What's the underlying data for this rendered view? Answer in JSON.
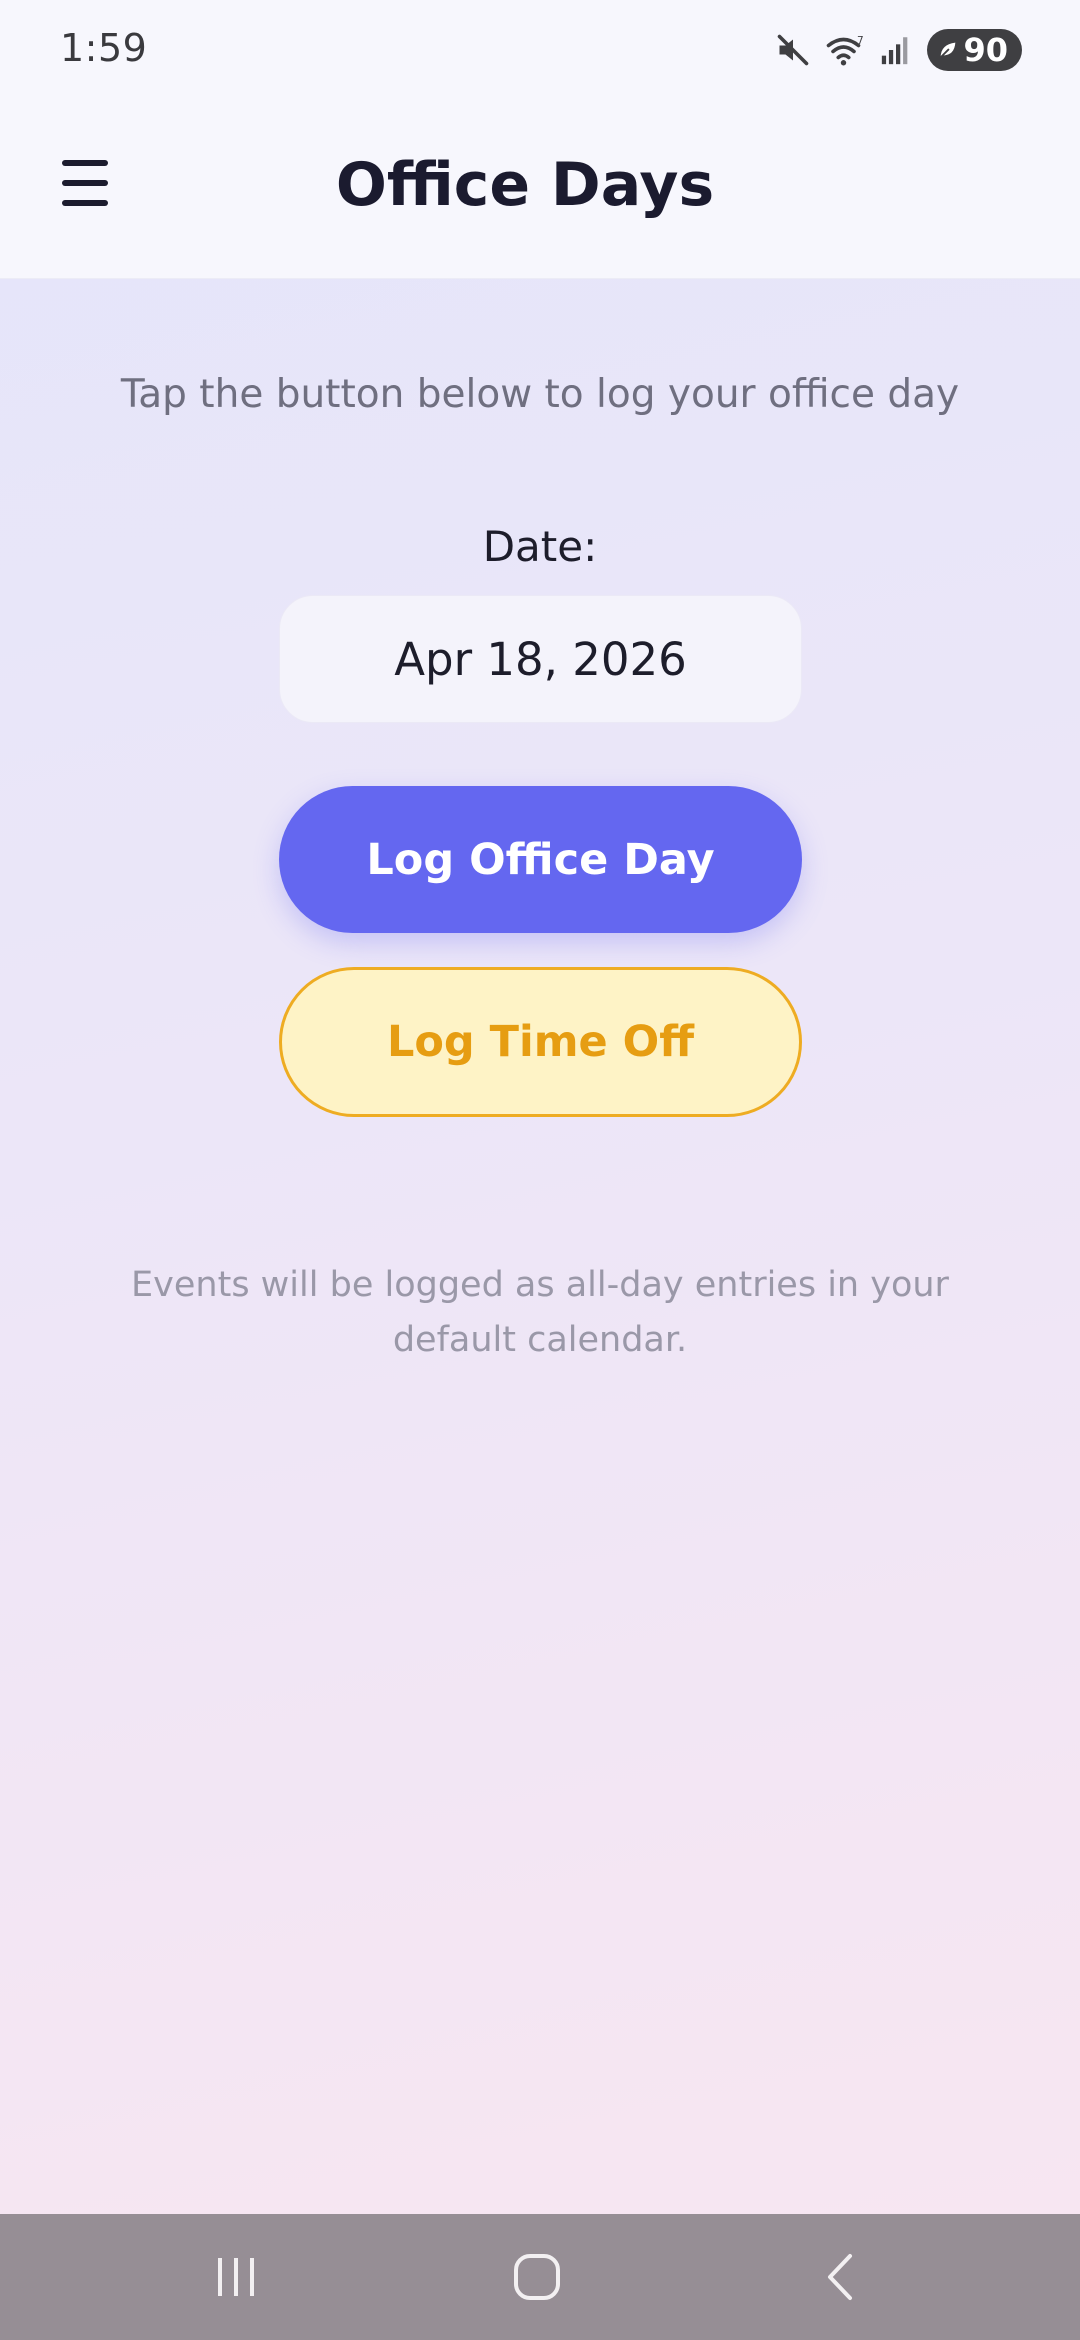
{
  "status_bar": {
    "time": "1:59",
    "battery_level": "90",
    "icons": [
      "mute-icon",
      "wifi-icon",
      "signal-icon",
      "battery-icon"
    ]
  },
  "app_bar": {
    "menu_icon": "hamburger-menu-icon",
    "title": "Office Days"
  },
  "main": {
    "instruction": "Tap the button below to log your office day",
    "date_label": "Date:",
    "date_value": "Apr 18, 2026",
    "primary_button_label": "Log Office Day",
    "secondary_button_label": "Log Time Off",
    "footnote": "Events will be logged as all-day entries in your default calendar."
  },
  "nav_bar": {
    "buttons": [
      "recent-apps-icon",
      "home-icon",
      "back-icon"
    ]
  },
  "colors": {
    "primary": "#6467f0",
    "secondary_bg": "#fef3c6",
    "secondary_text": "#e69d12",
    "secondary_border": "#eeac22",
    "title_text": "#1b1b2f"
  }
}
